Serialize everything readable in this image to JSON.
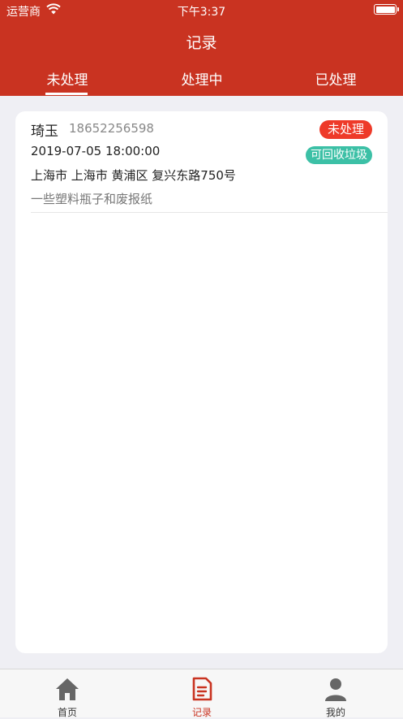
{
  "status_bar": {
    "carrier": "运营商",
    "time": "下午3:37"
  },
  "header": {
    "title": "记录"
  },
  "tabs": [
    {
      "label": "未处理",
      "active": true
    },
    {
      "label": "处理中",
      "active": false
    },
    {
      "label": "已处理",
      "active": false
    }
  ],
  "records": [
    {
      "name": "琦玉",
      "phone": "18652256598",
      "status": "未处理",
      "datetime": "2019-07-05 18:00:00",
      "category": "可回收垃圾",
      "address": "上海市 上海市 黄浦区 复兴东路750号",
      "note": "一些塑料瓶子和废报纸"
    }
  ],
  "tabbar": [
    {
      "label": "首页",
      "icon": "home-icon",
      "active": false
    },
    {
      "label": "记录",
      "icon": "document-icon",
      "active": true
    },
    {
      "label": "我的",
      "icon": "person-icon",
      "active": false
    }
  ],
  "colors": {
    "brand": "#c93321",
    "status_badge": "#ee3a29",
    "category_badge": "#3cc0a6",
    "background": "#efeff4"
  }
}
